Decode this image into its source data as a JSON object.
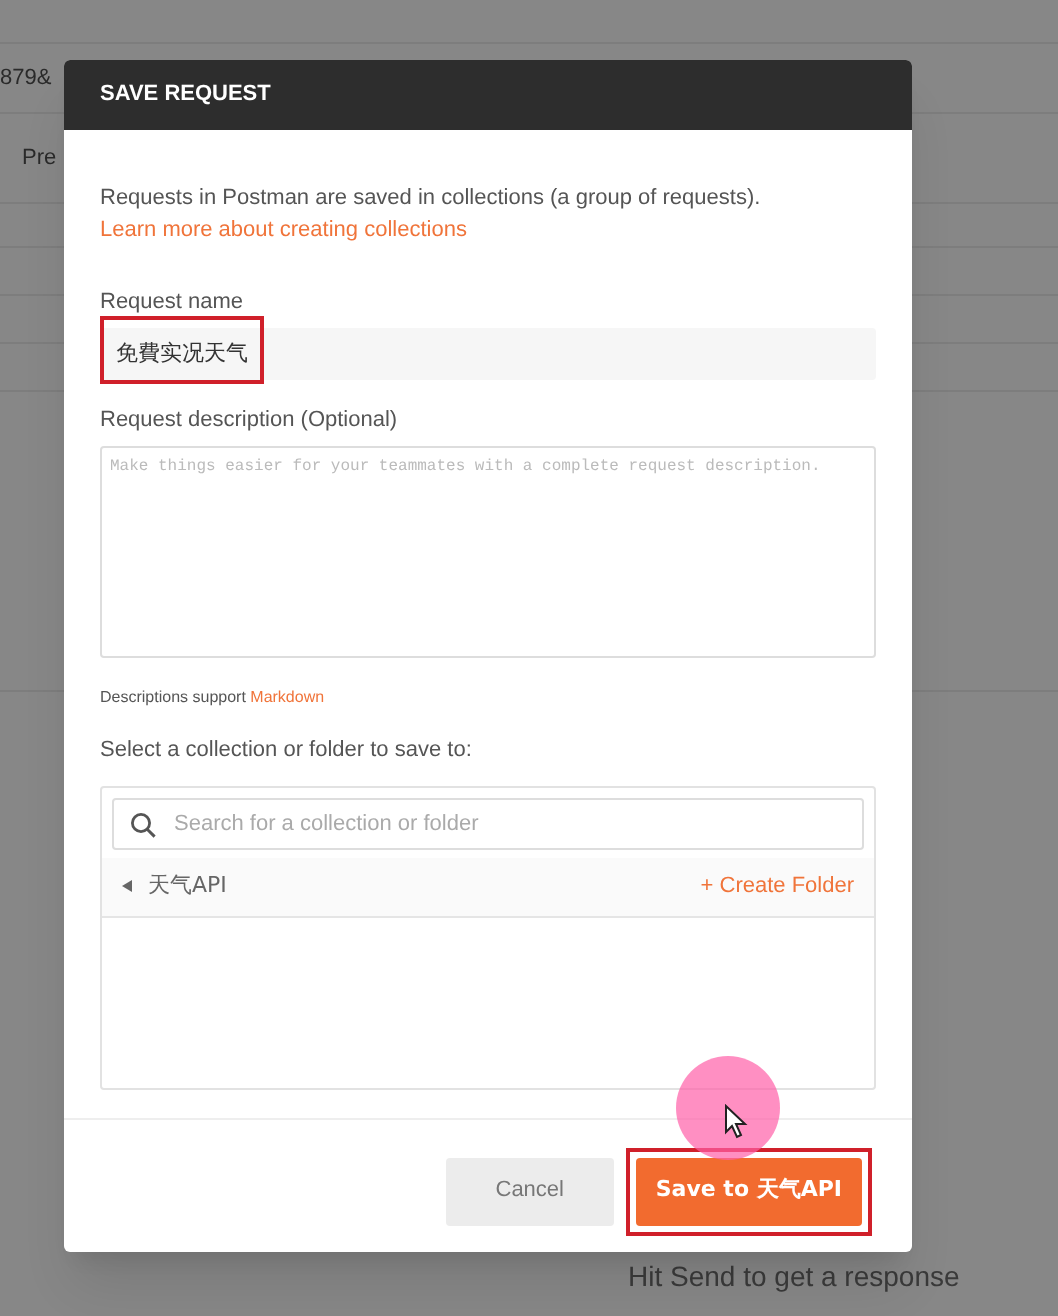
{
  "background": {
    "url_fragment": "879&",
    "tab_fragment": "Pre",
    "response_hint": "Hit Send to get a response"
  },
  "dialog": {
    "title": "SAVE REQUEST",
    "intro": "Requests in Postman are saved in collections (a group of requests).",
    "learn_link": "Learn more about creating collections",
    "name_label": "Request name",
    "name_value": "免費实况天气",
    "description_label": "Request description (Optional)",
    "description_placeholder": "Make things easier for your teammates with a complete request description.",
    "markdown_hint": "Descriptions support",
    "markdown_link": "Markdown",
    "select_label": "Select a collection or folder to save to:",
    "search_placeholder": "Search for a collection or folder",
    "collections": [
      {
        "name": "天气API",
        "expanded": false,
        "action": "+ Create Folder"
      }
    ],
    "buttons": [
      {
        "kind": "secondary",
        "label": "Cancel"
      },
      {
        "kind": "primary",
        "label": "Save to 天气API"
      }
    ]
  }
}
